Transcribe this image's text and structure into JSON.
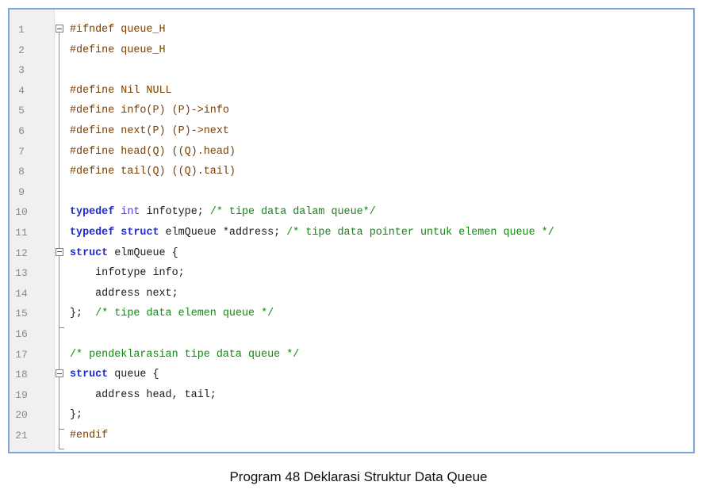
{
  "code_lines": [
    {
      "num": "1",
      "text": "#ifndef queue_H"
    },
    {
      "num": "2",
      "text": "#define queue_H"
    },
    {
      "num": "3",
      "text": ""
    },
    {
      "num": "4",
      "text": "#define Nil NULL"
    },
    {
      "num": "5",
      "text": "#define info(P) (P)->info"
    },
    {
      "num": "6",
      "text": "#define next(P) (P)->next"
    },
    {
      "num": "7",
      "text": "#define head(Q) ((Q).head)"
    },
    {
      "num": "8",
      "text": "#define tail(Q) ((Q).tail)"
    },
    {
      "num": "9",
      "text": ""
    },
    {
      "num": "10",
      "text": "typedef int infotype; /* tipe data dalam queue*/"
    },
    {
      "num": "11",
      "text": "typedef struct elmQueue *address; /* tipe data pointer untuk elemen queue */"
    },
    {
      "num": "12",
      "text": "struct elmQueue {"
    },
    {
      "num": "13",
      "text": "    infotype info;"
    },
    {
      "num": "14",
      "text": "    address next;"
    },
    {
      "num": "15",
      "text": "};  /* tipe data elemen queue */"
    },
    {
      "num": "16",
      "text": ""
    },
    {
      "num": "17",
      "text": "/* pendeklarasian tipe data queue */"
    },
    {
      "num": "18",
      "text": "struct queue {"
    },
    {
      "num": "19",
      "text": "    address head, tail;"
    },
    {
      "num": "20",
      "text": "};"
    },
    {
      "num": "21",
      "text": "#endif"
    }
  ],
  "caption": "Program 48 Deklarasi Struktur Data Queue",
  "colors": {
    "border": "#7fa6cf",
    "gutter_bg": "#f0f0f0",
    "line_number": "#8a8a8a",
    "preprocessor": "#7a3e00",
    "keyword": "#1e2bd6",
    "comment": "#118811"
  }
}
